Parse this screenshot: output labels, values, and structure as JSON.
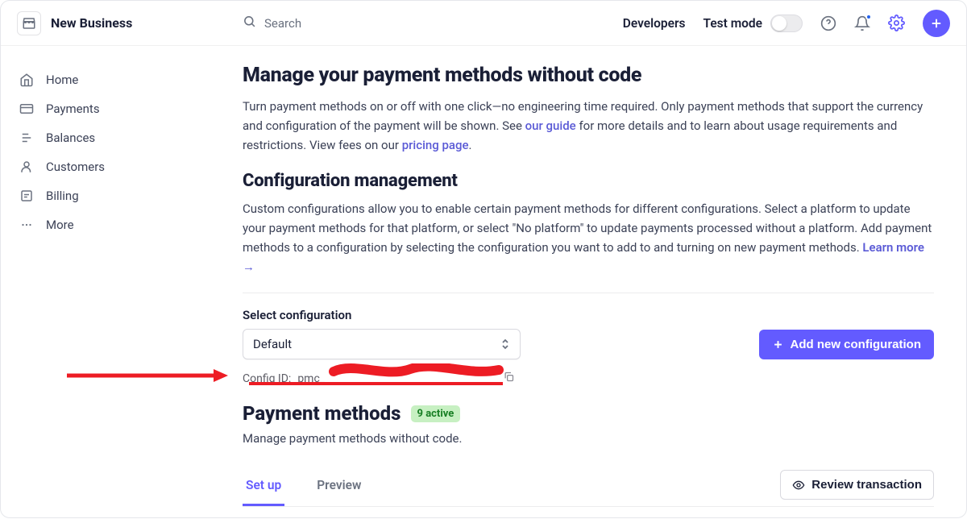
{
  "header": {
    "brand": "New Business",
    "search_placeholder": "Search",
    "developers": "Developers",
    "test_mode": "Test mode"
  },
  "sidebar": {
    "items": [
      {
        "label": "Home"
      },
      {
        "label": "Payments"
      },
      {
        "label": "Balances"
      },
      {
        "label": "Customers"
      },
      {
        "label": "Billing"
      },
      {
        "label": "More"
      }
    ]
  },
  "section1": {
    "title": "Manage your payment methods without code",
    "p_a": "Turn payment methods on or off with one click—no engineering time required. Only payment methods that support the currency and configuration of the payment will be shown. See ",
    "guide_link": "our guide",
    "p_b": " for more details and to learn about usage requirements and restrictions. View fees on our ",
    "pricing_link": "pricing page",
    "period": "."
  },
  "section2": {
    "title": "Configuration management",
    "p_a": "Custom configurations allow you to enable certain payment methods for different configurations. Select a platform to update your payment methods for that platform, or select \"No platform\" to update payments processed without a platform. Add payment methods to a configuration by selecting the configuration you want to add to and turning on new payment methods. ",
    "learn_more": "Learn more →"
  },
  "config": {
    "select_label": "Select configuration",
    "selected": "Default",
    "add_button": "Add new configuration",
    "config_id_label": "Config ID:",
    "config_id_value": "pmc_"
  },
  "payment_methods": {
    "title": "Payment methods",
    "badge": "9 active",
    "subtitle": "Manage payment methods without code."
  },
  "tabs": {
    "setup": "Set up",
    "preview": "Preview",
    "review": "Review transaction"
  }
}
